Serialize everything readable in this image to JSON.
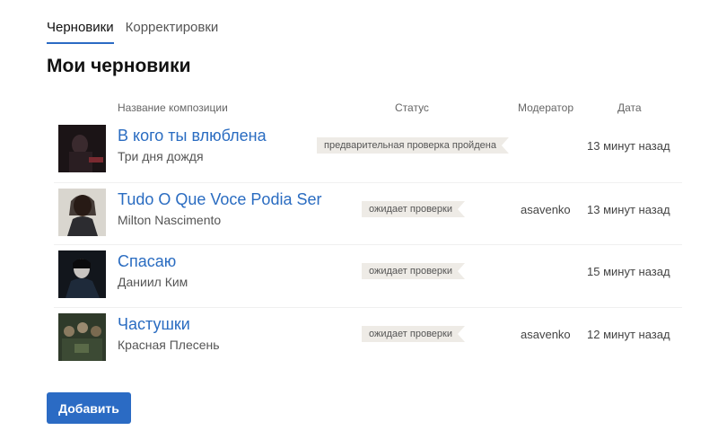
{
  "tabs": [
    {
      "label": "Черновики",
      "active": true
    },
    {
      "label": "Корректировки",
      "active": false
    }
  ],
  "page_title": "Мои черновики",
  "table": {
    "columns": {
      "name": "Название композиции",
      "status": "Статус",
      "moderator": "Модератор",
      "date": "Дата"
    },
    "rows": [
      {
        "title": "В кого ты влюблена",
        "artist": "Три дня дождя",
        "status": "предварительная проверка пройдена",
        "moderator": "",
        "date": "13 минут назад"
      },
      {
        "title": "Tudo O Que Voce Podia Ser",
        "artist": "Milton Nascimento",
        "status": "ожидает проверки",
        "moderator": "asavenko",
        "date": "13 минут назад"
      },
      {
        "title": "Спасаю",
        "artist": "Даниил Ким",
        "status": "ожидает проверки",
        "moderator": "",
        "date": "15 минут назад"
      },
      {
        "title": "Частушки",
        "artist": "Красная Плесень",
        "status": "ожидает проверки",
        "moderator": "asavenko",
        "date": "12 минут назад"
      }
    ]
  },
  "add_button": "Добавить",
  "colors": {
    "accent": "#2b6bc4",
    "link": "#2a6cc1",
    "badge_bg": "#eeebe6"
  }
}
